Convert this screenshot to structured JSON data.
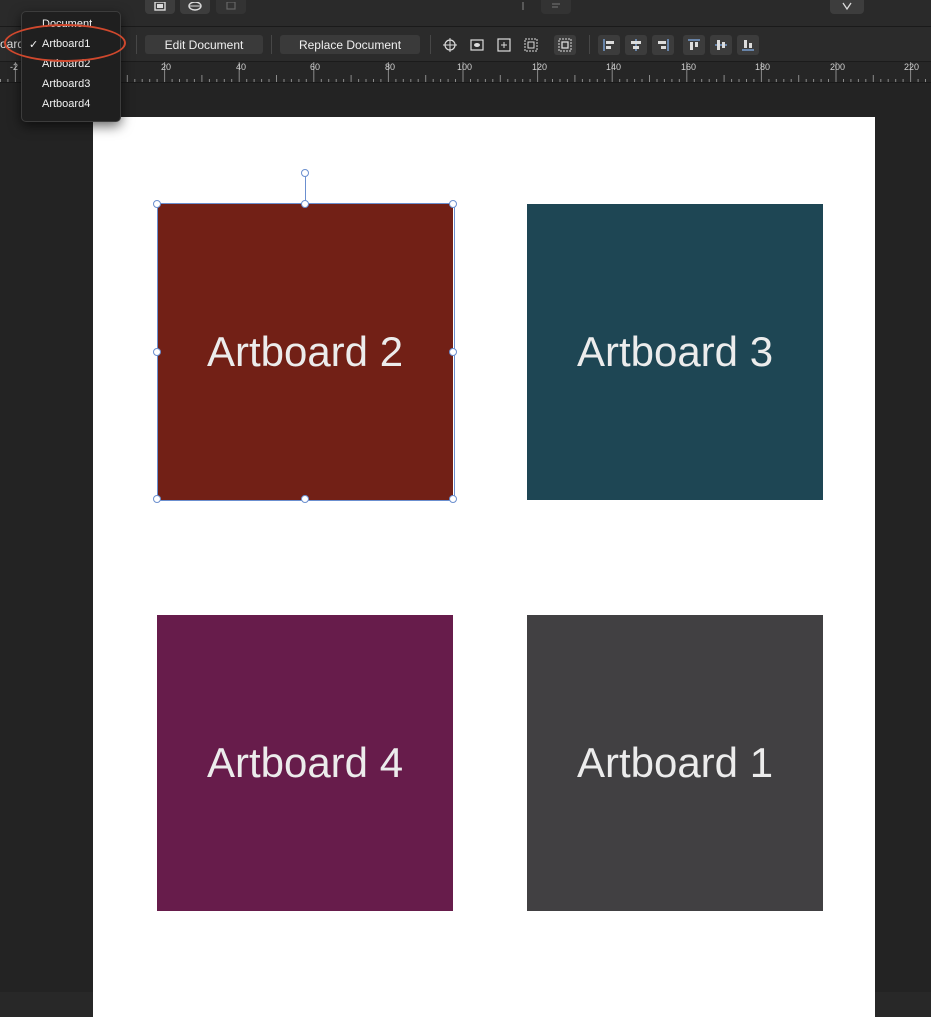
{
  "context_toolbar": {
    "left_label_fragment": "oard",
    "edit_document": "Edit Document",
    "replace_document": "Replace Document"
  },
  "artboard_dropdown": {
    "selected": "Artboard1",
    "items": [
      {
        "label": "Document",
        "checked": false
      },
      {
        "label": "Artboard1",
        "checked": true
      },
      {
        "label": "Artboard2",
        "checked": false
      },
      {
        "label": "Artboard3",
        "checked": false
      },
      {
        "label": "Artboard4",
        "checked": false
      }
    ],
    "check_mark": "✓"
  },
  "ruler": {
    "labels": [
      "-2",
      "20",
      "40",
      "60",
      "80",
      "100",
      "120",
      "140",
      "160",
      "180",
      "200",
      "220"
    ]
  },
  "artboards": [
    {
      "label": "Artboard 2",
      "color": "#722016",
      "selected": true
    },
    {
      "label": "Artboard 3",
      "color": "#1e4654",
      "selected": false
    },
    {
      "label": "Artboard 4",
      "color": "#671c4b",
      "selected": false
    },
    {
      "label": "Artboard 1",
      "color": "#414042",
      "selected": false
    }
  ],
  "colors": {
    "annotation": "#d0482d",
    "selection": "#6b8fcf",
    "page": "#ffffff"
  }
}
